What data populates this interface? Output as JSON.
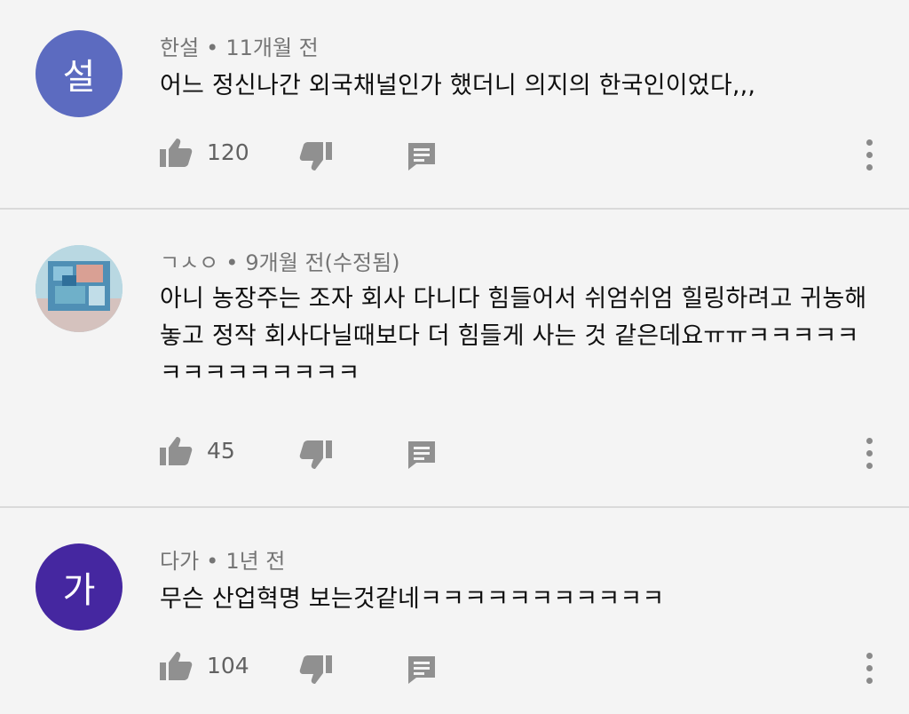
{
  "comments": [
    {
      "avatar_text": "설",
      "avatar_color": "#5c6bc0",
      "author": "한설",
      "time": "11개월 전",
      "text": "어느 정신나간 외국채널인가 했더니 의지의 한국인이었다,,,",
      "likes": "120"
    },
    {
      "avatar_text": "",
      "avatar_color": "#9ec7d6",
      "author": "ㄱㅅㅇ",
      "time": "9개월 전(수정됨)",
      "text": "아니 농장주는 조자 회사 다니다 힘들어서 쉬엄쉬엄 힐링하려고 귀농해 놓고 정작 회사다닐때보다 더 힘들게 사는 것 같은데요ㅠㅠㅋㅋㅋㅋㅋㅋㅋㅋㅋㅋㅋㅋㅋㅋ",
      "likes": "45"
    },
    {
      "avatar_text": "가",
      "avatar_color": "#4527a0",
      "author": "다가",
      "time": "1년 전",
      "text": "무슨 산업혁명 보는것같네ㅋㅋㅋㅋㅋㅋㅋㅋㅋㅋㅋ",
      "likes": "104"
    }
  ],
  "separator": "•",
  "icons": {
    "like": "thumb-up-icon",
    "dislike": "thumb-down-icon",
    "reply": "comment-icon",
    "menu": "more-vert-icon"
  },
  "colors": {
    "background": "#f4f4f4",
    "icon": "#909090",
    "meta_text": "#757575",
    "body_text": "#0f0f0f"
  }
}
